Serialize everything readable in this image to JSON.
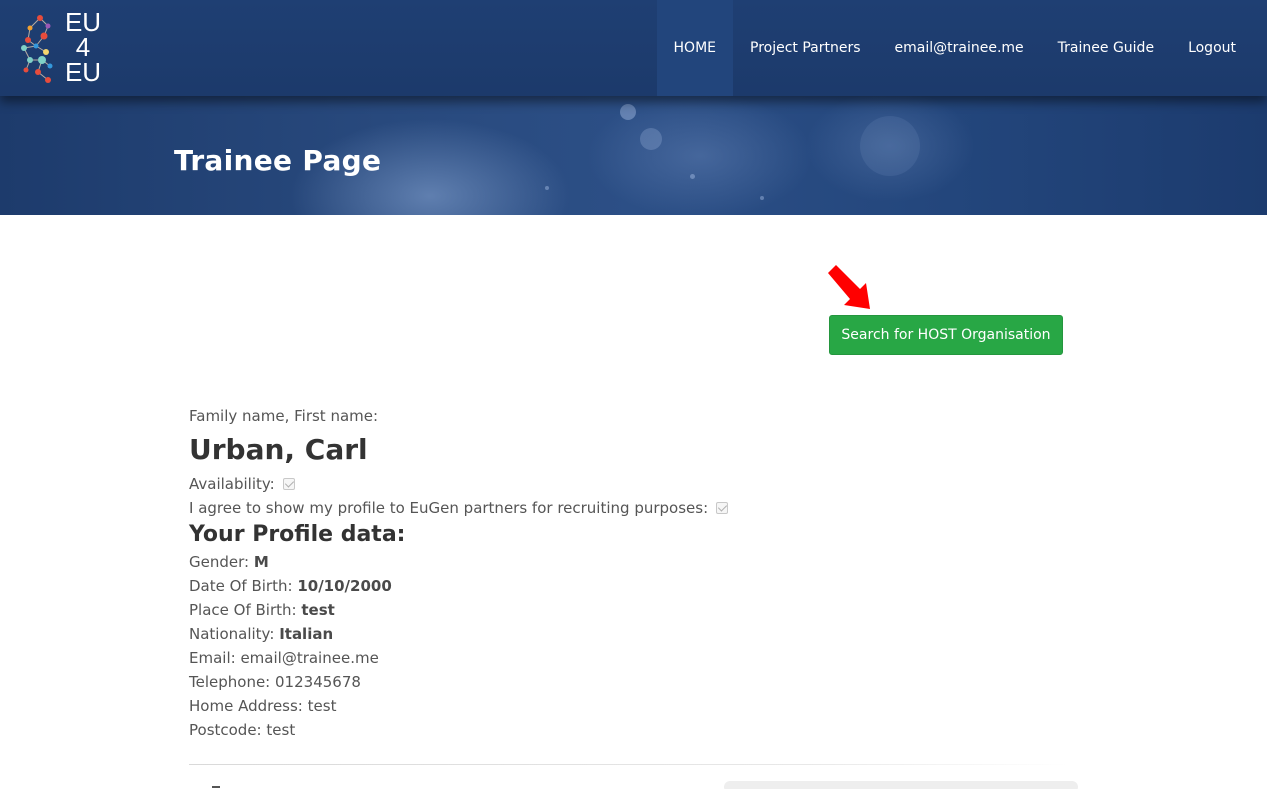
{
  "logo": {
    "line1": "EU",
    "line2": "4",
    "line3": "EU"
  },
  "nav": {
    "items": [
      {
        "label": "HOME"
      },
      {
        "label": "Project Partners"
      },
      {
        "label": "email@trainee.me"
      },
      {
        "label": "Trainee Guide"
      },
      {
        "label": "Logout"
      }
    ],
    "active_index": 0
  },
  "hero": {
    "title": "Trainee Page"
  },
  "actions": {
    "search_host_label": "Search for HOST Organisation"
  },
  "profile": {
    "name_label": "Family name, First name:",
    "name": "Urban, Carl",
    "availability_label": "Availability:",
    "availability_checked": true,
    "consent_label": "I agree to show my profile to EuGen partners for recruiting purposes:",
    "consent_checked": true,
    "section_title": "Your Profile data:",
    "gender_label": "Gender:",
    "gender": "M",
    "dob_label": "Date Of Birth:",
    "dob": "10/10/2000",
    "pob_label": "Place Of Birth:",
    "pob": "test",
    "nationality_label": "Nationality:",
    "nationality": "Italian",
    "email_label": "Email:",
    "email": "email@trainee.me",
    "telephone_label": "Telephone:",
    "telephone": "012345678",
    "address_label": "Home Address:",
    "address": "test",
    "postcode_label": "Postcode:",
    "postcode": "test"
  },
  "colors": {
    "navbar": "#1f3f73",
    "button_green": "#28a745",
    "arrow_red": "#ff0000"
  }
}
